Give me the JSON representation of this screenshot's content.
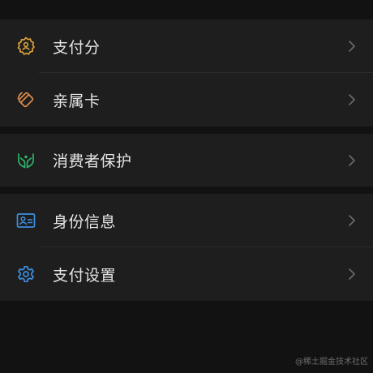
{
  "colors": {
    "background": "#121212",
    "card": "#1e1e1e",
    "text": "#e6e6e6",
    "chevron": "#6b6b6b",
    "gold": "#d9a23a",
    "orange": "#e08d4a",
    "green": "#2fb36b",
    "blue": "#3d8fe0"
  },
  "menu": {
    "items": [
      {
        "label": "支付分",
        "icon": "score-badge-icon"
      },
      {
        "label": "亲属卡",
        "icon": "family-card-icon"
      },
      {
        "label": "消费者保护",
        "icon": "protection-hands-icon"
      },
      {
        "label": "身份信息",
        "icon": "id-card-icon"
      },
      {
        "label": "支付设置",
        "icon": "gear-icon"
      }
    ]
  },
  "watermark": "@稀土掘金技术社区"
}
